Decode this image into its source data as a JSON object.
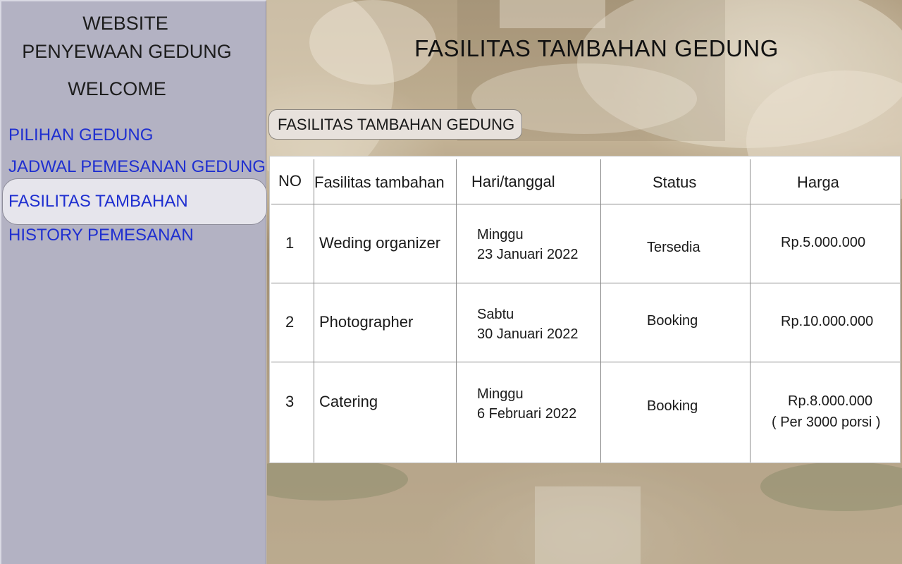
{
  "sidebar": {
    "brand_line1": "WEBSITE",
    "brand_line2": "PENYEWAAN GEDUNG",
    "welcome": "WELCOME",
    "nav": [
      {
        "label": "PILIHAN  GEDUNG",
        "active": false
      },
      {
        "label": "JADWAL PEMESANAN  GEDUNG",
        "active": false
      },
      {
        "label": "FASILITAS TAMBAHAN",
        "active": true
      },
      {
        "label": "HISTORY PEMESANAN",
        "active": false
      }
    ]
  },
  "main": {
    "title": "FASILITAS TAMBAHAN GEDUNG",
    "section_label": "FASILITAS TAMBAHAN GEDUNG",
    "table": {
      "headers": [
        "NO",
        "Fasilitas tambahan",
        "Hari/tanggal",
        "Status",
        "Harga"
      ],
      "rows": [
        {
          "no": "1",
          "fasilitas": "Weding organizer",
          "hari": "Minggu",
          "tanggal": "23 Januari 2022",
          "status": "Tersedia",
          "harga": "Rp.5.000.000",
          "harga_note": ""
        },
        {
          "no": "2",
          "fasilitas": "Photographer",
          "hari": "Sabtu",
          "tanggal": "30 Januari 2022",
          "status": "Booking",
          "harga": "Rp.10.000.000",
          "harga_note": ""
        },
        {
          "no": "3",
          "fasilitas": "Catering",
          "hari": "Minggu",
          "tanggal": "6 Februari 2022",
          "status": "Booking",
          "harga": "Rp.8.000.000",
          "harga_note": "( Per 3000 porsi )"
        }
      ]
    }
  },
  "colors": {
    "sidebar_bg": "#b3b2c3",
    "nav_link": "#1f2fd0",
    "active_nav_bg": "#e6e5ec",
    "table_bg": "#ffffff"
  }
}
